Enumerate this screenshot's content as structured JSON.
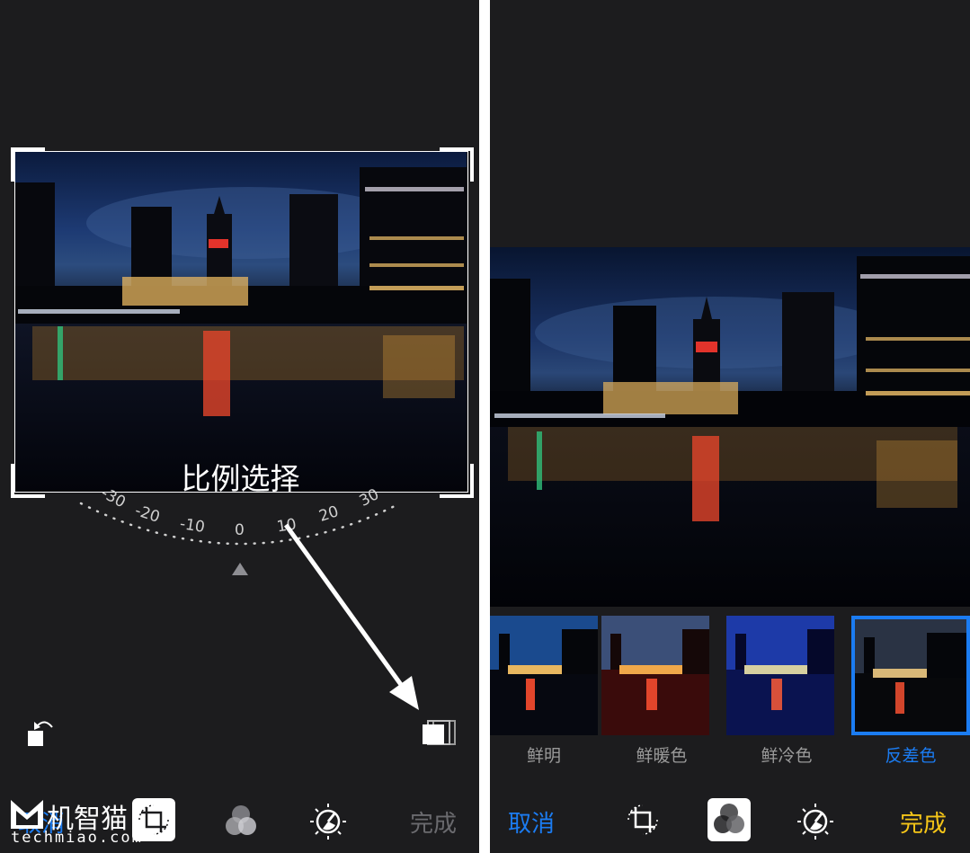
{
  "left": {
    "overlay_label": "比例选择",
    "dial_ticks": [
      "-30",
      "-20",
      "-10",
      "0",
      "10",
      "20",
      "30"
    ],
    "toolbar": {
      "cancel_label": "取消",
      "done_label": "完成"
    },
    "watermark": {
      "brand": "机智猫",
      "domain": "techmiao.com"
    }
  },
  "right": {
    "filters": [
      {
        "label": "鲜明"
      },
      {
        "label": "鲜暖色"
      },
      {
        "label": "鲜冷色"
      },
      {
        "label": "反差色"
      }
    ],
    "selected_filter_label": "反差色",
    "toolbar": {
      "cancel_label": "取消",
      "done_label": "完成"
    }
  },
  "colors": {
    "background": "#1c1c1e",
    "accent_blue": "#1b7cf2",
    "done_yellow": "#f5c518",
    "selection_border": "#1b7cf2",
    "arrow": "#ffffff"
  },
  "icons": [
    "rotate-icon",
    "aspect-ratio-icon",
    "crop-icon",
    "filters-icon",
    "adjust-icon"
  ]
}
